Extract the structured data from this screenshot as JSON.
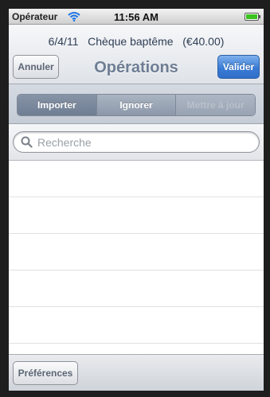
{
  "status_bar": {
    "carrier": "Opérateur",
    "time": "11:56 AM",
    "battery_color": "#3bc21f"
  },
  "header": {
    "date": "6/4/11",
    "description": "Chèque baptême",
    "amount": "(€40.00)",
    "title": "Opérations",
    "cancel_label": "Annuler",
    "validate_label": "Valider",
    "accent_color": "#3a7bd5"
  },
  "segments": {
    "import_label": "Importer",
    "ignore_label": "Ignorer",
    "update_label": "Mettre à jour",
    "selected": "Importer"
  },
  "search": {
    "placeholder": "Recherche",
    "value": "",
    "icon": "search-icon"
  },
  "list": {
    "rows": [
      "",
      "",
      "",
      "",
      "",
      ""
    ]
  },
  "toolbar": {
    "preferences_label": "Préférences"
  }
}
